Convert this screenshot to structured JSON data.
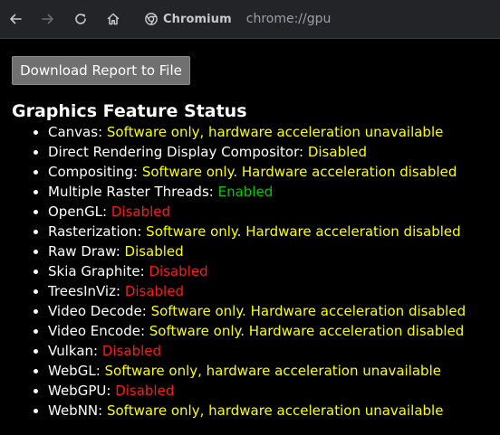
{
  "browser": {
    "chip_label": "Chromium",
    "url": "chrome://gpu",
    "icons": {
      "back": "arrow-left-icon",
      "forward": "arrow-right-icon",
      "reload": "reload-icon",
      "home": "home-icon",
      "chip": "chromium-logo-icon"
    }
  },
  "page": {
    "download_button_label": "Download Report to File",
    "section_title": "Graphics Feature Status",
    "status_colors": {
      "software": "#ffff00",
      "disabled": "#ff1a1a",
      "enabled": "#00cc00"
    },
    "features": [
      {
        "name": "Canvas",
        "status": "Software only, hardware acceleration unavailable",
        "kind": "software"
      },
      {
        "name": "Direct Rendering Display Compositor",
        "status": "Disabled",
        "kind": "software"
      },
      {
        "name": "Compositing",
        "status": "Software only. Hardware acceleration disabled",
        "kind": "software"
      },
      {
        "name": "Multiple Raster Threads",
        "status": "Enabled",
        "kind": "enabled"
      },
      {
        "name": "OpenGL",
        "status": "Disabled",
        "kind": "disabled"
      },
      {
        "name": "Rasterization",
        "status": "Software only. Hardware acceleration disabled",
        "kind": "software"
      },
      {
        "name": "Raw Draw",
        "status": "Disabled",
        "kind": "software"
      },
      {
        "name": "Skia Graphite",
        "status": "Disabled",
        "kind": "disabled"
      },
      {
        "name": "TreesInViz",
        "status": "Disabled",
        "kind": "disabled"
      },
      {
        "name": "Video Decode",
        "status": "Software only. Hardware acceleration disabled",
        "kind": "software"
      },
      {
        "name": "Video Encode",
        "status": "Software only. Hardware acceleration disabled",
        "kind": "software"
      },
      {
        "name": "Vulkan",
        "status": "Disabled",
        "kind": "disabled"
      },
      {
        "name": "WebGL",
        "status": "Software only, hardware acceleration unavailable",
        "kind": "software"
      },
      {
        "name": "WebGPU",
        "status": "Disabled",
        "kind": "disabled"
      },
      {
        "name": "WebNN",
        "status": "Software only, hardware acceleration unavailable",
        "kind": "software"
      }
    ]
  }
}
